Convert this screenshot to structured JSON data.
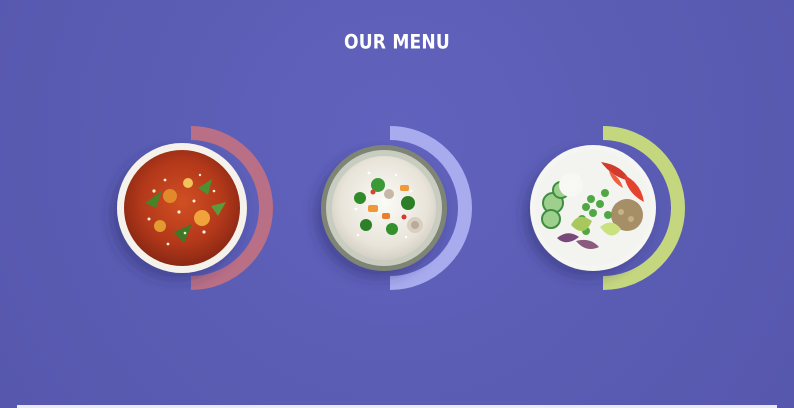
{
  "section": {
    "title": "OUR MENU"
  },
  "dishes": [
    {
      "icon": "soup-bowl-icon",
      "accent": "#b96f85"
    },
    {
      "icon": "rice-bowl-icon",
      "accent": "#a9abef"
    },
    {
      "icon": "salad-bowl-icon",
      "accent": "#c5d77e"
    }
  ],
  "colors": {
    "background": "#5b5db5",
    "title": "#ffffff"
  }
}
